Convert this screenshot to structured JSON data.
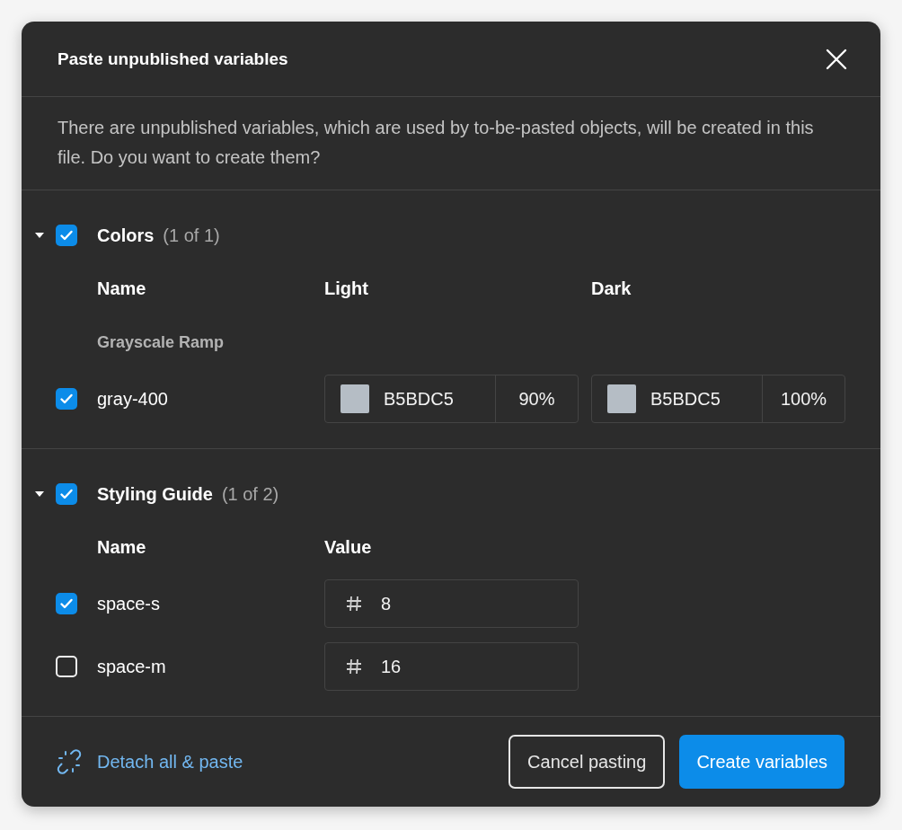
{
  "dialog": {
    "title": "Paste unpublished variables",
    "description": "There are unpublished variables, which are used by to-be-pasted objects, will be created in this file. Do you want to create them?"
  },
  "groups": [
    {
      "name": "Colors",
      "count": "(1 of 1)",
      "expanded": true,
      "checked": true,
      "columns": [
        "Name",
        "Light",
        "Dark"
      ],
      "rows": [
        {
          "kind": "heading",
          "label": "Grayscale Ramp"
        },
        {
          "kind": "color",
          "name": "gray-400",
          "checked": true,
          "values": [
            {
              "hex": "B5BDC5",
              "opacity": "90%"
            },
            {
              "hex": "B5BDC5",
              "opacity": "100%"
            }
          ]
        }
      ]
    },
    {
      "name": "Styling Guide",
      "count": "(1 of 2)",
      "expanded": true,
      "checked": true,
      "columns": [
        "Name",
        "Value"
      ],
      "rows": [
        {
          "kind": "number",
          "name": "space-s",
          "checked": true,
          "value": "8"
        },
        {
          "kind": "number",
          "name": "space-m",
          "checked": false,
          "value": "16"
        }
      ]
    }
  ],
  "footer": {
    "link": "Detach all & paste",
    "buttons": [
      {
        "label": "Cancel pasting",
        "kind": "secondary"
      },
      {
        "label": "Create variables",
        "kind": "primary"
      }
    ]
  }
}
